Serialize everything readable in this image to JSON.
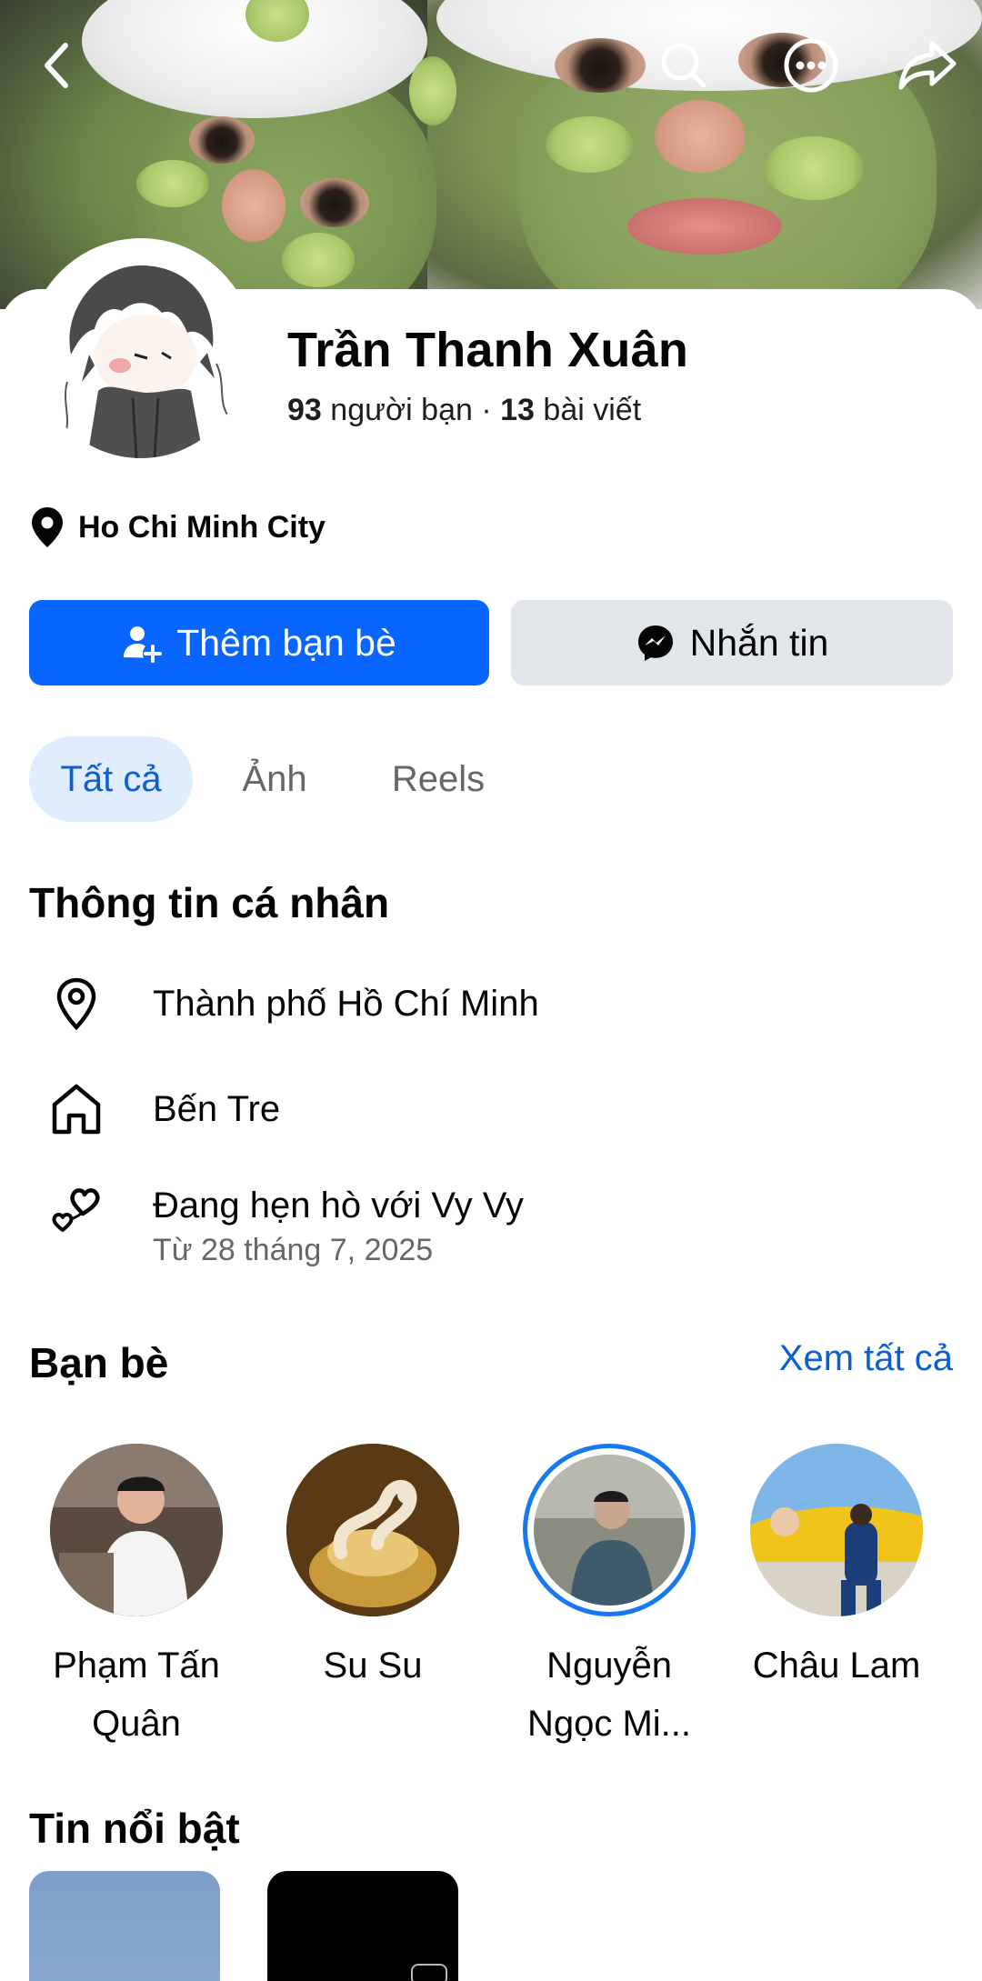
{
  "header": {
    "back_icon": "back-arrow-icon",
    "search_icon": "search-icon",
    "more_icon": "more-options-icon",
    "share_icon": "share-icon"
  },
  "profile": {
    "name": "Trần Thanh Xuân",
    "friends_count": "93",
    "friends_label": "người bạn",
    "separator": "·",
    "posts_count": "13",
    "posts_label": "bài viết",
    "location": "Ho Chi Minh City"
  },
  "actions": {
    "add_friend_label": "Thêm bạn bè",
    "message_label": "Nhắn tin",
    "accent_color": "#0866ff"
  },
  "tabs": [
    {
      "label": "Tất cả",
      "active": true
    },
    {
      "label": "Ảnh",
      "active": false
    },
    {
      "label": "Reels",
      "active": false
    }
  ],
  "about": {
    "title": "Thông tin cá nhân",
    "items": [
      {
        "icon": "location-pin-icon",
        "text": "Thành phố Hồ Chí Minh"
      },
      {
        "icon": "home-icon",
        "text": "Bến Tre"
      },
      {
        "icon": "hearts-icon",
        "text": "Đang hẹn hò với Vy Vy",
        "sub": "Từ 28 tháng 7, 2025"
      }
    ]
  },
  "friends": {
    "title": "Bạn bè",
    "see_all": "Xem tất cả",
    "list": [
      {
        "line1": "Phạm Tấn",
        "line2": "Quân"
      },
      {
        "line1": "Su Su",
        "line2": ""
      },
      {
        "line1": "Nguyễn",
        "line2": "Ngọc Mi..."
      },
      {
        "line1": "Châu Lam",
        "line2": ""
      }
    ]
  },
  "highlights": {
    "title": "Tin nổi bật"
  }
}
